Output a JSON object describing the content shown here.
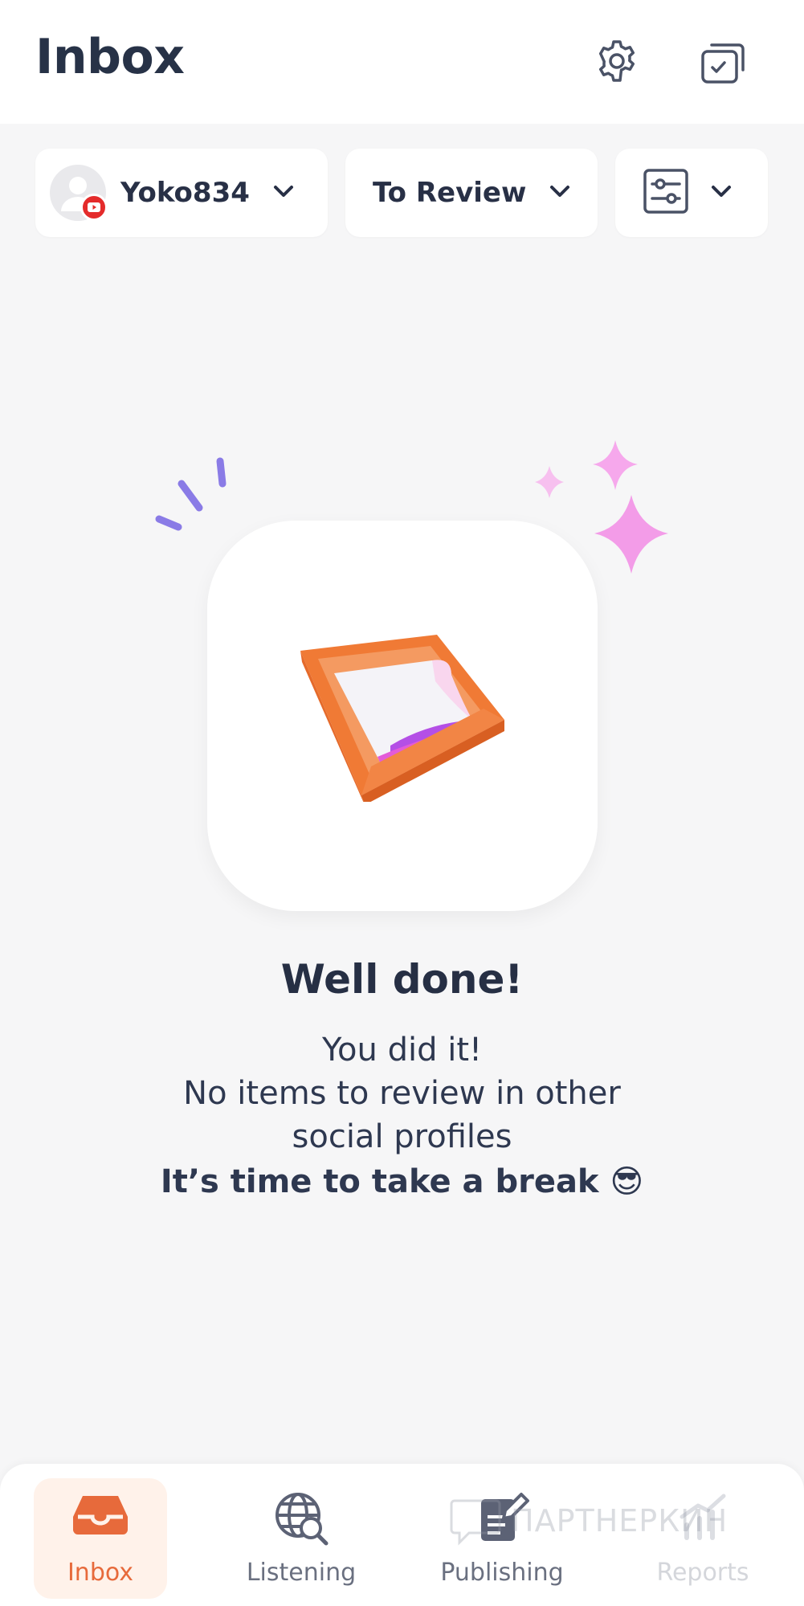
{
  "header": {
    "title": "Inbox",
    "icons": [
      "gear-icon",
      "tasks-icon"
    ]
  },
  "filters": {
    "account": {
      "name": "Yoko834",
      "network_badge": "youtube-icon"
    },
    "status": {
      "label": "To Review"
    },
    "settings": {
      "icon": "sliders-icon"
    }
  },
  "empty_state": {
    "headline": "Well done!",
    "line1": "You did it!",
    "line2": "No items to review in other",
    "line3": "social profiles",
    "line4": "It’s time to take a break 😎"
  },
  "bottom_nav": {
    "items": [
      {
        "label": "Inbox",
        "icon": "inbox-tray-icon",
        "active": true
      },
      {
        "label": "Listening",
        "icon": "globe-search-icon",
        "active": false
      },
      {
        "label": "Publishing",
        "icon": "publishing-icon",
        "active": false
      },
      {
        "label": "Reports",
        "icon": "reports-icon",
        "active": false
      }
    ]
  },
  "watermark": "ПАРТНЕРКИН",
  "colors": {
    "accent": "#e76a3b",
    "text_dark": "#273247",
    "background": "#f6f6f7",
    "sparkle_pink": "#f4a3ec",
    "accent_purple": "#8a7be6"
  }
}
